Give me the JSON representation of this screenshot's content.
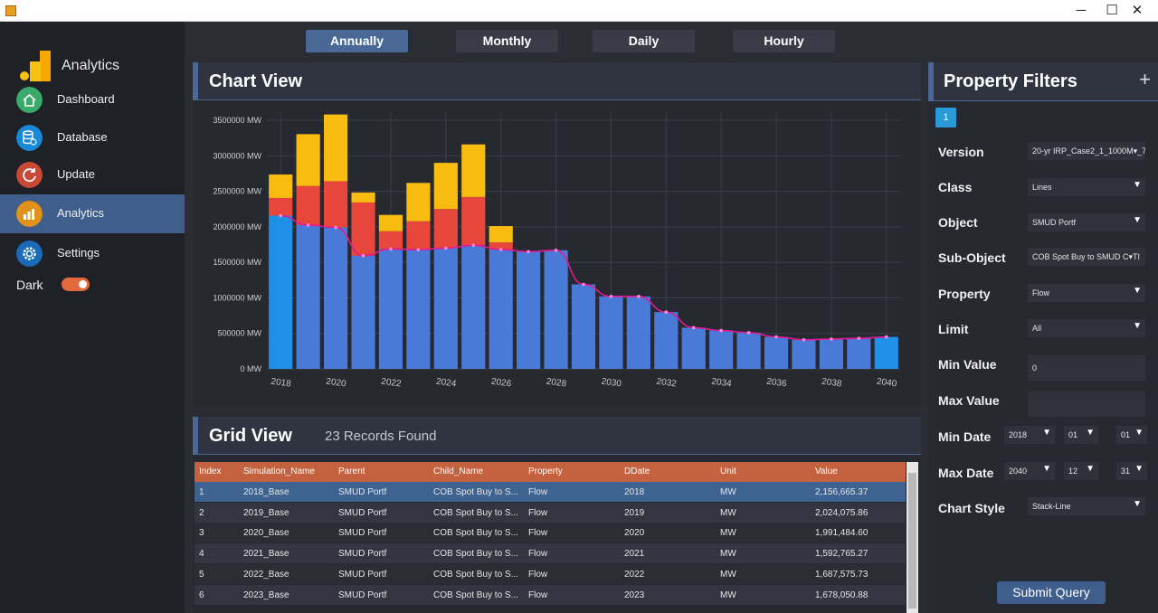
{
  "window": {
    "minimize": "─",
    "maximize": "☐",
    "close": "✕"
  },
  "sidebar": {
    "app_name": "Analytics",
    "items": [
      {
        "label": "Dashboard",
        "icon": "home-icon",
        "color": "#3aaa6a"
      },
      {
        "label": "Database",
        "icon": "database-icon",
        "color": "#1a88d8"
      },
      {
        "label": "Update",
        "icon": "refresh-icon",
        "color": "#c84a36"
      },
      {
        "label": "Analytics",
        "icon": "bar-chart-icon",
        "color": "#e0921a"
      },
      {
        "label": "Settings",
        "icon": "gear-icon",
        "color": "#1a6ab8"
      }
    ],
    "active": "Analytics",
    "dark_label": "Dark",
    "dark_mode": true
  },
  "tabs": [
    {
      "label": "Annually",
      "active": true
    },
    {
      "label": "Monthly"
    },
    {
      "label": "Daily"
    },
    {
      "label": "Hourly"
    }
  ],
  "chart_panel": {
    "title": "Chart View"
  },
  "chart_data": {
    "type": "bar",
    "style": "stacked bar with line",
    "categories": [
      "2018",
      "2019",
      "2020",
      "2021",
      "2022",
      "2023",
      "2024",
      "2025",
      "2026",
      "2027",
      "2028",
      "2029",
      "2030",
      "2031",
      "2032",
      "2033",
      "2034",
      "2035",
      "2036",
      "2037",
      "2038",
      "2039",
      "2040"
    ],
    "series": [
      {
        "values": [
          2156665,
          2024076,
          1991485,
          1592765,
          1687576,
          1678051,
          1700000,
          1740000,
          1680000,
          1650000,
          1670000,
          1190000,
          1020000,
          1020000,
          800000,
          580000,
          540000,
          510000,
          450000,
          410000,
          420000,
          430000,
          450000
        ],
        "color": "#4a7ad8"
      },
      {
        "values": [
          250000,
          550000,
          650000,
          750000,
          250000,
          400000,
          550000,
          680000,
          100000,
          0,
          0,
          0,
          0,
          0,
          0,
          0,
          0,
          0,
          0,
          0,
          0,
          0,
          0
        ],
        "color": "#e8463a"
      },
      {
        "values": [
          330000,
          730000,
          940000,
          140000,
          230000,
          540000,
          650000,
          740000,
          230000,
          0,
          0,
          0,
          0,
          0,
          0,
          0,
          0,
          0,
          0,
          0,
          0,
          0,
          0
        ],
        "color": "#f8bc10"
      }
    ],
    "line_values": [
      2156665,
      2024076,
      1991485,
      1592765,
      1687576,
      1678051,
      1700000,
      1740000,
      1680000,
      1650000,
      1670000,
      1190000,
      1020000,
      1020000,
      800000,
      580000,
      540000,
      510000,
      450000,
      410000,
      420000,
      430000,
      450000
    ],
    "line_color": "#e01a96",
    "ylim": [
      0,
      3500000
    ],
    "yticks": [
      "0 MW",
      "500000 MW",
      "1000000 MW",
      "1500000 MW",
      "2000000 MW",
      "2500000 MW",
      "3000000 MW",
      "3500000 MW"
    ],
    "xticks": [
      "2018",
      "2020",
      "2022",
      "2024",
      "2026",
      "2028",
      "2030",
      "2032",
      "2034",
      "2036",
      "2038",
      "2040"
    ],
    "grid": true
  },
  "grid_panel": {
    "title": "Grid View",
    "records": "23 Records Found",
    "columns": [
      "Index",
      "Simulation_Name",
      "Parent",
      "Child_Name",
      "Property",
      "DDate",
      "Unit",
      "Value"
    ],
    "rows": [
      [
        "1",
        "2018_Base",
        "SMUD Portf",
        "COB Spot Buy to S...",
        "Flow",
        "2018",
        "MW",
        "2,156,665.37"
      ],
      [
        "2",
        "2019_Base",
        "SMUD Portf",
        "COB Spot Buy to S...",
        "Flow",
        "2019",
        "MW",
        "2,024,075.86"
      ],
      [
        "3",
        "2020_Base",
        "SMUD Portf",
        "COB Spot Buy to S...",
        "Flow",
        "2020",
        "MW",
        "1,991,484.60"
      ],
      [
        "4",
        "2021_Base",
        "SMUD Portf",
        "COB Spot Buy to S...",
        "Flow",
        "2021",
        "MW",
        "1,592,765.27"
      ],
      [
        "5",
        "2022_Base",
        "SMUD Portf",
        "COB Spot Buy to S...",
        "Flow",
        "2022",
        "MW",
        "1,687,575.73"
      ],
      [
        "6",
        "2023_Base",
        "SMUD Portf",
        "COB Spot Buy to S...",
        "Flow",
        "2023",
        "MW",
        "1,678,050.88"
      ]
    ]
  },
  "filters": {
    "title": "Property Filters",
    "add": "+",
    "badge": "1",
    "version_label": "Version",
    "version_value": "20-yr IRP_Case2_1_1000M▾_7",
    "class_label": "Class",
    "class_value": "Lines",
    "object_label": "Object",
    "object_value": "SMUD Portf",
    "subobject_label": "Sub-Object",
    "subobject_value": "COB Spot Buy to SMUD C▾TI",
    "property_label": "Property",
    "property_value": "Flow",
    "limit_label": "Limit",
    "limit_value": "All",
    "minvalue_label": "Min Value",
    "minvalue_value": "0",
    "maxvalue_label": "Max Value",
    "maxvalue_value": "",
    "mindate_label": "Min Date",
    "mindate_year": "2018",
    "mindate_month": "01",
    "mindate_day": "01",
    "maxdate_label": "Max Date",
    "maxdate_year": "2040",
    "maxdate_month": "12",
    "maxdate_day": "31",
    "chartstyle_label": "Chart Style",
    "chartstyle_value": "Stack-Line",
    "submit": "Submit Query"
  }
}
